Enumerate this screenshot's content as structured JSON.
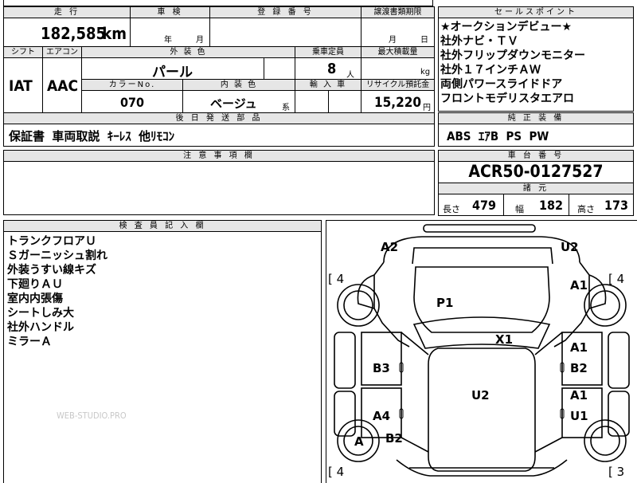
{
  "header_row": {
    "mileage_label": "走 行",
    "inspection_label": "車 検",
    "registration_label": "登 録 番 号",
    "transfer_deadline_label": "譲渡書類期限",
    "selling_points_label": "セールスポイント"
  },
  "mileage": {
    "value": "182,585",
    "unit": "km"
  },
  "inspection": {
    "year_label": "年",
    "month_label": "月"
  },
  "transfer_deadline": {
    "month_label": "月",
    "day_label": "日"
  },
  "row2": {
    "shift_label": "シフト",
    "aircon_label": "エアコン",
    "exterior_color_label": "外 装 色",
    "capacity_label": "乗車定員",
    "max_load_label": "最大積載量"
  },
  "shift": "IAT",
  "aircon": "AAC",
  "exterior_color": "パール",
  "capacity": {
    "value": "8",
    "unit": "人"
  },
  "max_load": {
    "unit": "kg"
  },
  "row3": {
    "color_no_label": "カラーNo.",
    "interior_color_label": "内 装 色",
    "import_label": "輸 入 車",
    "recycle_label": "リサイクル預託金"
  },
  "color_no": "070",
  "interior_color": {
    "value": "ベージュ",
    "suffix": "系"
  },
  "recycle_fee": {
    "value": "15,220",
    "unit": "円"
  },
  "accessories": {
    "label": "後 日 発 送 部 品",
    "items": "保証書  車両取説  ｷｰﾚｽ  他ﾘﾓｺﾝ"
  },
  "caution": {
    "label": "注 意 事 項 欄"
  },
  "selling_points": [
    "★オークションデビュー★",
    "社外ナビ・ＴＶ",
    "社外フリップダウンモニター",
    "社外１７インチＡＷ",
    "両側パワースライドドア",
    "フロントモデリスタエアロ"
  ],
  "equipment": {
    "label": "純 正 装 備",
    "items": "ABS  ｴｱB  PS  PW"
  },
  "chassis": {
    "label": "車 台 番 号",
    "number": "ACR50-0127527"
  },
  "specs": {
    "label": "諸 元",
    "length_label": "長さ",
    "length": "479",
    "width_label": "幅",
    "width": "182",
    "height_label": "高さ",
    "height": "173"
  },
  "inspector": {
    "label": "検 査 員 記 入 欄",
    "notes": [
      "トランクフロアＵ",
      "Ｓガーニッシュ割れ",
      "外装うすい線キズ",
      "下廻りＡＵ",
      "室内内張傷",
      "シートしみ大",
      "社外ハンドル",
      "ミラーＡ"
    ],
    "watermark": "WEB-STUDIO.PRO"
  },
  "diagram": {
    "marks": {
      "A2": "A2",
      "U2_top": "U2",
      "P1": "P1",
      "A1_top": "A1",
      "X1": "X1",
      "A1_mid": "A1",
      "B3": "B3",
      "B2_right": "B2",
      "U2_center": "U2",
      "A1_low": "A1",
      "A4": "A4",
      "U1": "U1",
      "A_tire": "A",
      "B2_left": "B2"
    },
    "tread": {
      "front_left": "[ 4",
      "front_right": "[ 4",
      "rear_left": "[ 4",
      "rear_right": "[ 3"
    }
  }
}
